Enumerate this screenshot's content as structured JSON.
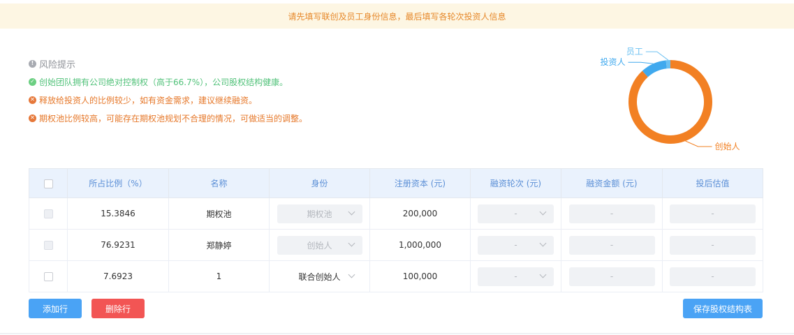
{
  "banner": {
    "text": "请先填写联创及员工身份信息，最后填写各轮次投资人信息"
  },
  "risk": {
    "title": "风险提示",
    "items": [
      {
        "status": "ok",
        "text": "创始团队拥有公司绝对控制权（高于66.7%），公司股权结构健康。"
      },
      {
        "status": "warn",
        "text": "释放给投资人的比例较少，如有资金需求，建议继续融资。"
      },
      {
        "status": "warn",
        "text": "期权池比例较高，可能存在期权池规划不合理的情况，可做适当的调整。"
      }
    ]
  },
  "chart_data": {
    "type": "pie",
    "donut": true,
    "slices": [
      {
        "label": "创始人",
        "value": 88.3,
        "color": "#f28023"
      },
      {
        "label": "投资人",
        "value": 10.0,
        "color": "#40a9ee"
      },
      {
        "label": "员工",
        "value": 1.7,
        "color": "#6cc1f2"
      }
    ]
  },
  "table": {
    "headers": [
      "所占比例（%）",
      "名称",
      "身份",
      "注册资本 (元)",
      "融资轮次 (元)",
      "融资金额 (元)",
      "投后估值"
    ],
    "rows": [
      {
        "ratio": "15.3846",
        "name": "期权池",
        "identity": "期权池",
        "capital": "200,000",
        "round": "-",
        "amount": "-",
        "valuation": "-"
      },
      {
        "ratio": "76.9231",
        "name": "郑静婷",
        "identity": "创始人",
        "capital": "1,000,000",
        "round": "-",
        "amount": "-",
        "valuation": "-"
      },
      {
        "ratio": "7.6923",
        "name": "1",
        "identity": "联合创始人",
        "capital": "100,000",
        "round": "-",
        "amount": "-",
        "valuation": "-"
      }
    ]
  },
  "buttons": {
    "add": "添加行",
    "delete": "删除行",
    "save": "保存股权结构表"
  }
}
